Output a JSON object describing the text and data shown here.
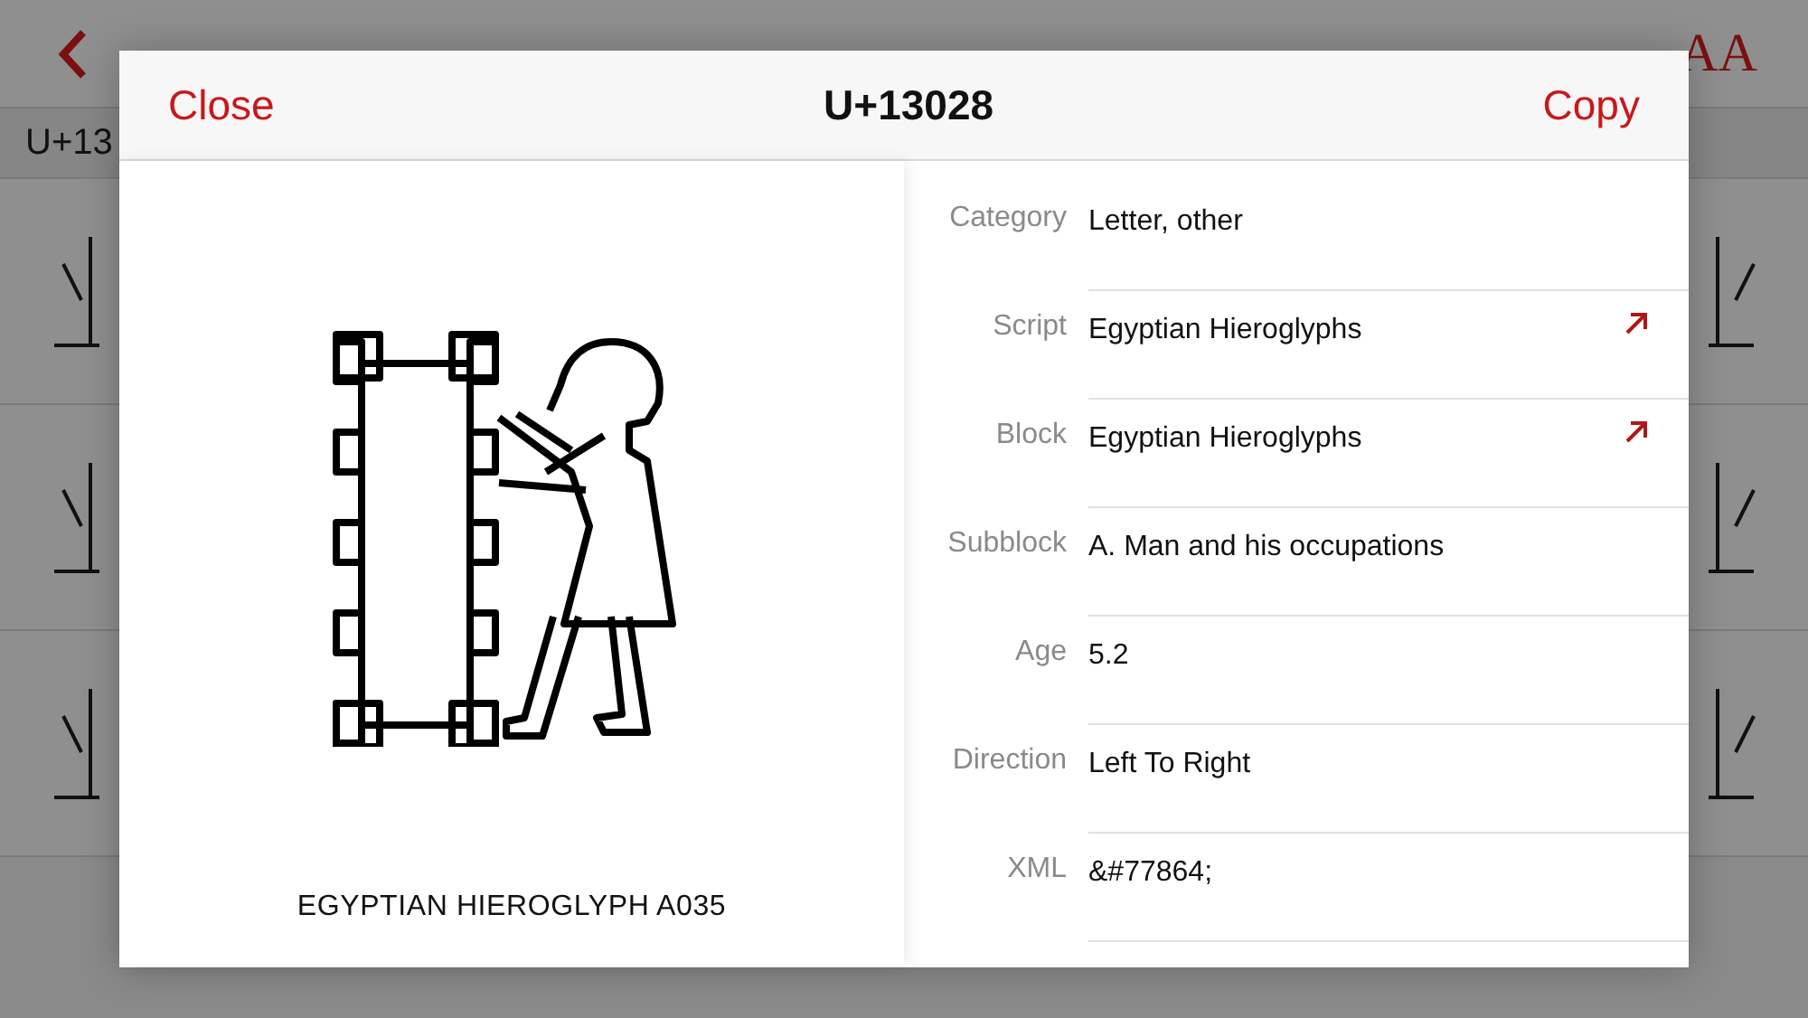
{
  "background": {
    "font_button": "AA",
    "section_header": "U+13"
  },
  "sheet": {
    "close": "Close",
    "title": "U+13028",
    "copy": "Copy",
    "glyph_name": "EGYPTIAN HIEROGLYPH A035",
    "properties": [
      {
        "label": "Category",
        "value": "Letter, other",
        "link": false
      },
      {
        "label": "Script",
        "value": "Egyptian Hieroglyphs",
        "link": true
      },
      {
        "label": "Block",
        "value": "Egyptian Hieroglyphs",
        "link": true
      },
      {
        "label": "Subblock",
        "value": "A. Man and his occupations",
        "link": false
      },
      {
        "label": "Age",
        "value": "5.2",
        "link": false
      },
      {
        "label": "Direction",
        "value": "Left To Right",
        "link": false
      },
      {
        "label": "XML",
        "value": "&#77864;",
        "link": false
      }
    ]
  }
}
